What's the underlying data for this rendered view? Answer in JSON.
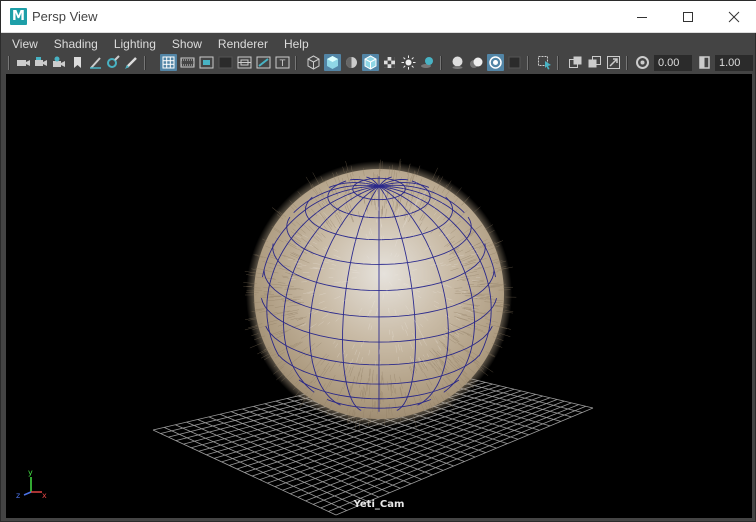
{
  "window": {
    "title": "Persp View",
    "app_logo": "M"
  },
  "menu": {
    "items": [
      "View",
      "Shading",
      "Lighting",
      "Show",
      "Renderer",
      "Help"
    ]
  },
  "toolbar": {
    "icons": [
      "camera-select-icon",
      "camera-attributes-icon",
      "bookmarks-icon",
      "image-plane-icon",
      "2d-pan-zoom-icon",
      "grease-pencil-icon",
      "grid-icon",
      "film-gate-icon",
      "resolution-gate-icon",
      "gate-mask-icon",
      "field-chart-icon",
      "safe-action-icon",
      "safe-title-icon",
      "wireframe-icon",
      "smooth-shade-icon",
      "default-material-icon",
      "wireframe-on-shaded-icon",
      "textured-icon",
      "use-all-lights-icon",
      "shadows-icon",
      "screen-space-ao-icon",
      "motion-blur-icon",
      "multisample-aa-icon",
      "depth-of-field-icon",
      "isolate-select-icon",
      "xray-icon",
      "xray-joints-icon",
      "xray-components-icon",
      "exposure-icon",
      "gamma-icon"
    ],
    "exposure_value": "0.00",
    "gamma_value": "1.00"
  },
  "viewport": {
    "camera_label": "Yeti_Cam",
    "axis_labels": {
      "x": "x",
      "y": "y",
      "z": "z"
    },
    "colors": {
      "background": "#000000",
      "grid": "#9a9a9a",
      "fur": "#b8a58a",
      "wireframe": "#1c1c8a",
      "axis_x": "#e04343",
      "axis_y": "#43e043",
      "axis_z": "#4b72e6"
    }
  }
}
